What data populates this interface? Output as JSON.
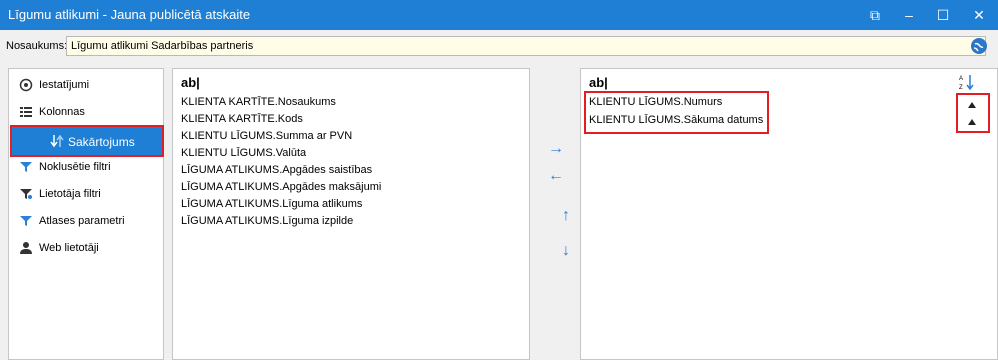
{
  "window": {
    "title": "Līgumu atlikumi - Jauna publicētā atskaite",
    "controls": {
      "restore": "⧉",
      "minimize": "–",
      "maximize": "☐",
      "close": "✕"
    }
  },
  "header": {
    "name_label": "Nosaukums:",
    "name_value": "Līgumu atlikumi Sadarbības partneris",
    "globe_icon": "globe-icon"
  },
  "sidebar": {
    "items": [
      {
        "label": "Iestatījumi",
        "icon": "gear-icon"
      },
      {
        "label": "Kolonnas",
        "icon": "columns-icon"
      },
      {
        "label": "Sakārtojums",
        "icon": "sort-icon",
        "active": true
      },
      {
        "label": "Noklusētie filtri",
        "icon": "filter-icon"
      },
      {
        "label": "Lietotāja filtri",
        "icon": "user-filter-icon"
      },
      {
        "label": "Atlases parametri",
        "icon": "funnel-icon"
      },
      {
        "label": "Web lietotāji",
        "icon": "user-icon"
      }
    ]
  },
  "available": {
    "header": "ab|",
    "rows": [
      "KLIENTA KARTĪTE.Nosaukums",
      "KLIENTA KARTĪTE.Kods",
      "KLIENTU LĪGUMS.Summa ar PVN",
      "KLIENTU LĪGUMS.Valūta",
      "LĪGUMA ATLIKUMS.Apgādes saistības",
      "LĪGUMA ATLIKUMS.Apgādes maksājumi",
      "LĪGUMA ATLIKUMS.Līguma atlikums",
      "LĪGUMA ATLIKUMS.Līguma izpilde"
    ]
  },
  "selected": {
    "header": "ab|",
    "rows": [
      "KLIENTU LĪGUMS.Numurs",
      "KLIENTU LĪGUMS.Sākuma datums"
    ],
    "sort_icon": "sort-az-icon"
  },
  "buttons": {
    "add": "→",
    "remove": "←",
    "up": "↑",
    "down": "↓"
  },
  "colors": {
    "titlebar": "#1e7fd4",
    "highlight": "#e21d24",
    "input_bg": "#fffce8"
  }
}
